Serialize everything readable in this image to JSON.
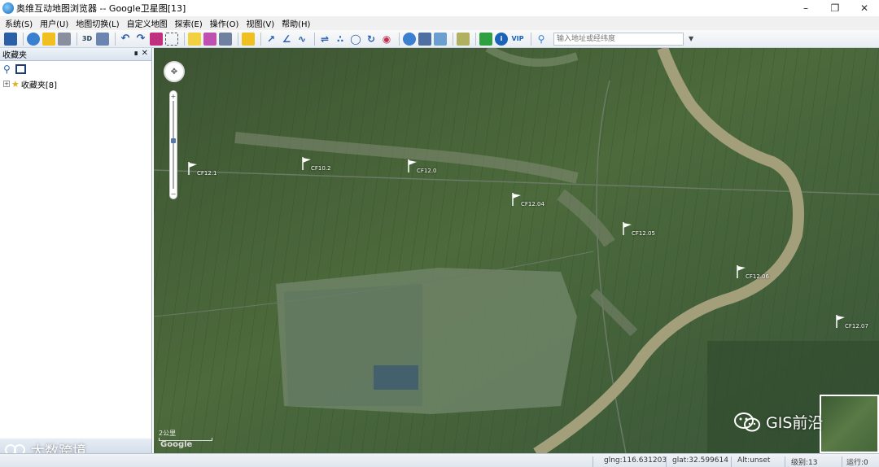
{
  "window": {
    "title": "奥维互动地图浏览器 -- Google卫星图[13]",
    "min_icon": "minimize-icon",
    "max_icon": "restore-icon",
    "close_icon": "close-icon"
  },
  "menu": [
    "系统(S)",
    "用户(U)",
    "地图切换(L)",
    "自定义地图",
    "探索(E)",
    "操作(O)",
    "视图(V)",
    "帮助(H)"
  ],
  "toolbar": {
    "search_placeholder": "输入地址或经纬度",
    "vip_label": "VIP",
    "btn_3d": "3D"
  },
  "sidebar": {
    "title": "收藏夹",
    "pin": "ᵖ",
    "close": "✕",
    "tree": [
      {
        "expander": "+",
        "label": "收藏夹[8]"
      }
    ]
  },
  "map": {
    "markers": [
      {
        "label": "CF12.1"
      },
      {
        "label": "CF10.2"
      },
      {
        "label": "CF12.0"
      },
      {
        "label": "CF12.04"
      },
      {
        "label": "CF12.05"
      },
      {
        "label": "CF12.06"
      },
      {
        "label": "CF12.07"
      }
    ],
    "scale_label": "2公里",
    "google_logo": "Google",
    "watermark": "GIS前沿"
  },
  "bottom_watermark": "大数跨境",
  "status": {
    "glng": "glng:116.631203",
    "glat": "glat:32.599614",
    "alt": "Alt:unset",
    "level": "级别:13",
    "run": "运行:0"
  },
  "colors": {
    "accent": "#1a63b8",
    "river": "#a39f7a",
    "field_dark": "#2f4a2c"
  }
}
